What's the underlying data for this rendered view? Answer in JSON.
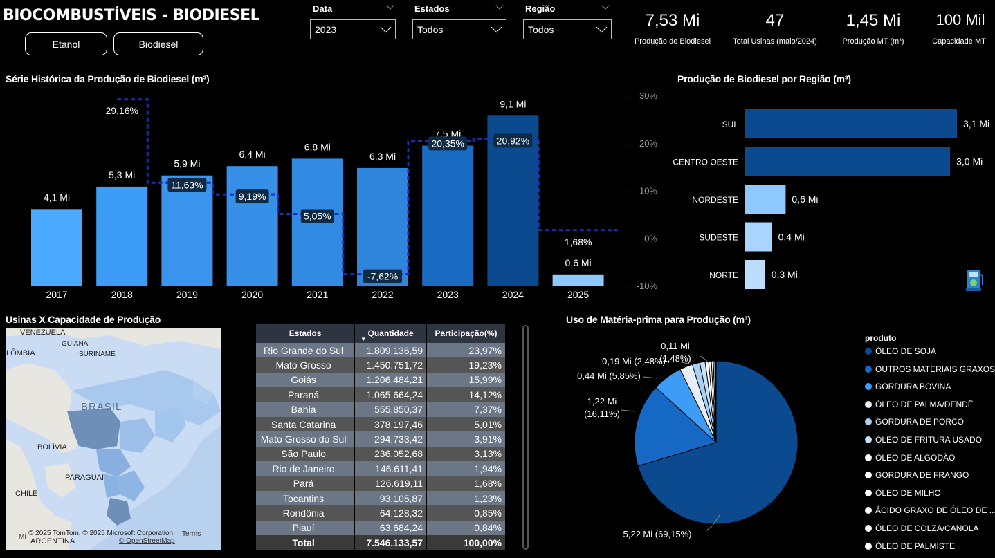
{
  "header": {
    "title": "BIOCOMBUSTÍVEIS - BIODIESEL",
    "btn_etanol": "Etanol",
    "btn_biodiesel": "Biodiesel"
  },
  "filters": {
    "data_label": "Data",
    "data_value": "2023",
    "estados_label": "Estados",
    "estados_value": "Todos",
    "regiao_label": "Região",
    "regiao_value": "Todos"
  },
  "kpis": [
    {
      "value": "7,53 Mi",
      "label": "Produção de Biodiesel"
    },
    {
      "value": "47",
      "label": "Total Usinas (maio/2024)"
    },
    {
      "value": "1,45 Mi",
      "label": "Produção MT (m³)"
    },
    {
      "value": "100 Mil",
      "label": "Capacidade MT"
    }
  ],
  "serie": {
    "title": "Série Histórica da Produção de Biodiesel (m³)",
    "right_ticks": [
      "30%",
      "20%",
      "10%",
      "0%",
      "-10%"
    ]
  },
  "regiao": {
    "title": "Produção de Biodiesel por Região (m³)"
  },
  "usinas": {
    "title": "Usinas X Capacidade de Produção",
    "map_labels": [
      "VENEZUELA",
      "GUIANA",
      "SURINAME",
      "LÔMBIA",
      "BRASIL",
      "BOLÍVIA",
      "PARAGUAI",
      "CHILE",
      "ARGENTINA"
    ],
    "map_credit": "© 2025 TomTom, © 2025 Microsoft Corporation,",
    "map_terms": "Terms",
    "map_osm": "© OpenStreetMap",
    "map_logo": "Mi"
  },
  "table": {
    "headers": [
      "Estados",
      "Quantidade",
      "Participação(%)"
    ],
    "rows": [
      [
        "Rio Grande do Sul",
        "1.809.136,59",
        "23,97%"
      ],
      [
        "Mato Grosso",
        "1.450.751,72",
        "19,23%"
      ],
      [
        "Goiás",
        "1.206.484,21",
        "15,99%"
      ],
      [
        "Paraná",
        "1.065.664,24",
        "14,12%"
      ],
      [
        "Bahia",
        "555.850,37",
        "7,37%"
      ],
      [
        "Santa Catarina",
        "378.197,46",
        "5,01%"
      ],
      [
        "Mato Grosso do Sul",
        "294.733,42",
        "3,91%"
      ],
      [
        "São Paulo",
        "236.052,68",
        "3,13%"
      ],
      [
        "Rio de Janeiro",
        "146.611,41",
        "1,94%"
      ],
      [
        "Pará",
        "126.619,11",
        "1,68%"
      ],
      [
        "Tocantins",
        "93.105,87",
        "1,23%"
      ],
      [
        "Rondônia",
        "64.128,32",
        "0,85%"
      ],
      [
        "Piauí",
        "63.684,24",
        "0,84%"
      ]
    ],
    "total": [
      "Total",
      "7.546.133,57",
      "100,00%"
    ]
  },
  "materia": {
    "title": "Uso de Matéria-prima para Produção (m³)",
    "legend_title": "produto"
  },
  "chart_data": [
    {
      "type": "bar",
      "title": "Série Histórica da Produção de Biodiesel (m³)",
      "categories": [
        "2017",
        "2018",
        "2019",
        "2020",
        "2021",
        "2022",
        "2023",
        "2024",
        "2025"
      ],
      "values": [
        4.1,
        5.3,
        5.9,
        6.4,
        6.8,
        6.3,
        7.5,
        9.1,
        0.6
      ],
      "value_labels": [
        "4,1 Mi",
        "5,3 Mi",
        "5,9 Mi",
        "6,4 Mi",
        "6,8 Mi",
        "6,3 Mi",
        "7,5 Mi",
        "9,1 Mi",
        "0,6 Mi"
      ],
      "growth_pct": [
        null,
        29.16,
        11.63,
        9.19,
        5.05,
        -7.62,
        20.35,
        20.92,
        1.68
      ],
      "growth_labels": [
        "",
        "29,16%",
        "11,63%",
        "9,19%",
        "5,05%",
        "-7,62%",
        "20,35%",
        "20,92%",
        "1,68%"
      ],
      "bar_colors": [
        "#4aa8ff",
        "#3d9cf5",
        "#3a94ed",
        "#3690e8",
        "#338ae2",
        "#2f84dc",
        "#1a6bc2",
        "#0b4a8f",
        "#8ec8ff"
      ],
      "ylim_right": [
        -10,
        30
      ]
    },
    {
      "type": "bar",
      "orientation": "horizontal",
      "title": "Produção de Biodiesel por Região (m³)",
      "categories": [
        "SUL",
        "CENTRO OESTE",
        "NORDESTE",
        "SUDESTE",
        "NORTE"
      ],
      "values": [
        3.1,
        3.0,
        0.6,
        0.4,
        0.3
      ],
      "value_labels": [
        "3,1 Mi",
        "3,0 Mi",
        "0,6 Mi",
        "0,4 Mi",
        "0,3 Mi"
      ],
      "bar_colors": [
        "#0b4a8f",
        "#0b4a8f",
        "#8ec8ff",
        "#a8d4ff",
        "#b9dcff"
      ]
    },
    {
      "type": "pie",
      "title": "Uso de Matéria-prima para Produção (m³)",
      "legend_title": "produto",
      "categories": [
        "ÓLEO DE SOJA",
        "OUTROS MATERIAIS GRAXOS",
        "GORDURA BOVINA",
        "ÓLEO DE PALMA/DENDÊ",
        "GORDURA DE PORCO",
        "ÓLEO DE FRITURA USADO",
        "ÓLEO DE ALGODÃO",
        "GORDURA DE FRANGO",
        "ÓLEO DE MILHO",
        "ÁCIDO GRAXO DE ÓLEO DE ...",
        "ÓLEO DE COLZA/CANOLA",
        "ÓLEO DE PALMISTE"
      ],
      "values": [
        5.22,
        1.22,
        0.44,
        0.19,
        0.11,
        0.08,
        0.05,
        0.04,
        0.03,
        0.02,
        0.01,
        0.01
      ],
      "data_labels": [
        {
          "slice": "ÓLEO DE SOJA",
          "label": "5,22 Mi (69,15%)"
        },
        {
          "slice": "OUTROS MATERIAIS GRAXOS",
          "label_lines": [
            "1,22 Mi",
            "(16,11%)"
          ]
        },
        {
          "slice": "GORDURA BOVINA",
          "label": "0,44 Mi (5,85%)"
        },
        {
          "slice": "ÓLEO DE PALMA/DENDÊ",
          "label": "0,19 Mi (2,48%)"
        },
        {
          "slice": "GORDURA DE PORCO",
          "label_lines": [
            "0,11 Mi",
            "(1,48%)"
          ]
        }
      ],
      "colors": [
        "#0b4a8f",
        "#1568c4",
        "#3d9cf5",
        "#e6eef8",
        "#a8d0f5",
        "#c6e0f9",
        "#ffffff",
        "#ffffff",
        "#ffffff",
        "#ffffff",
        "#ffffff",
        "#ffffff"
      ],
      "legend_colors": [
        "#0b4a8f",
        "#1568c4",
        "#3d9cf5",
        "#e6eef8",
        "#a8d0f5",
        "#c6e0f9",
        "#ffffff",
        "#ffffff",
        "#ffffff",
        "#ffffff",
        "#ffffff",
        "#ffffff"
      ]
    }
  ]
}
